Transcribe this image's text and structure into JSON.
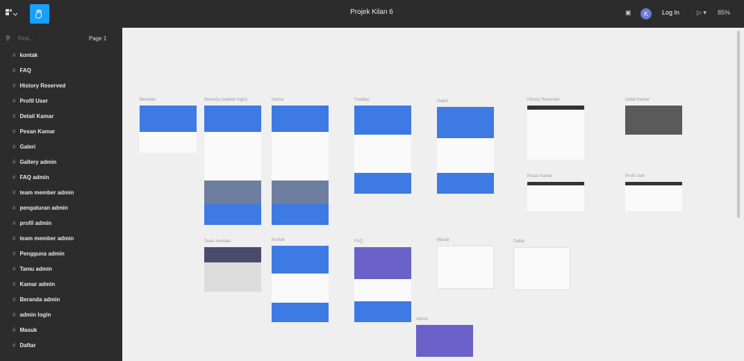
{
  "topbar": {
    "title": "Projek Kilan 6",
    "login_label": "Log In",
    "zoom": "85%",
    "avatar_initial": "K",
    "present_label": "▷ ▾"
  },
  "sidebar": {
    "search_placeholder": "Find...",
    "page_selector": "Page 1",
    "layers": [
      "kontak",
      "FAQ",
      "History Reserved",
      "Profil User",
      "Detail Kamar",
      "Pesan Kamar",
      "Galeri",
      "Gallery admin",
      "FAQ admin",
      "team member admin",
      "pengaturan admin",
      "profil admin",
      "team member admin",
      "Pengguna admin",
      "Tamu admin",
      "Kamar admin",
      "Beranda admin",
      "admin login",
      "Masuk",
      "Daftar"
    ]
  },
  "canvas": {
    "frame_labels": [
      "Beranda",
      "Beranda (setelah login)",
      "Kamar",
      "Fasilitas",
      "Galeri",
      "History Reserved",
      "Detail Kamar",
      "Pesan Kamar",
      "Profil User",
      "Team member",
      "Kontak",
      "FAQ",
      "Masuk",
      "Daftar",
      "Admin"
    ]
  },
  "colors": {
    "toolbar_bg": "#2c2c2c",
    "accent": "#18a0fb",
    "canvas_bg": "#efefef",
    "frame_blue": "#3d7ae4"
  }
}
